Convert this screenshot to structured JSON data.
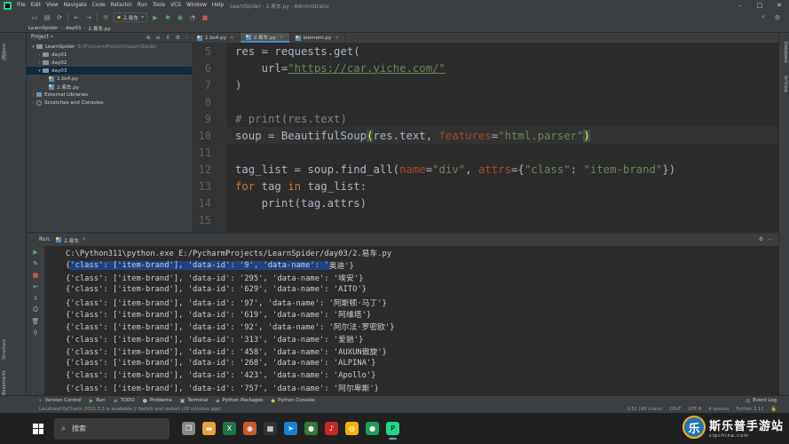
{
  "window": {
    "menu": [
      "File",
      "Edit",
      "View",
      "Navigate",
      "Code",
      "Refactor",
      "Run",
      "Tools",
      "VCS",
      "Window",
      "Help"
    ],
    "title": "LearnSpider - 2.易车.py - Administrator"
  },
  "toolbar": {
    "run_config": "2.易车"
  },
  "breadcrumb": [
    "LearnSpider",
    "day03",
    "2.易车.py"
  ],
  "left_stripe": {
    "project": "Project",
    "structure": "Structure",
    "bookmarks": "Bookmarks"
  },
  "right_stripe": {
    "database": "Database",
    "sciview": "SciView"
  },
  "project_panel": {
    "title": "Project",
    "tree": [
      {
        "label": "LearnSpider",
        "path": "E:\\PycharmProjects\\LearnSpider",
        "type": "folder",
        "indent": 0,
        "expanded": true
      },
      {
        "label": "day01",
        "type": "folder",
        "indent": 1
      },
      {
        "label": "day02",
        "type": "folder",
        "indent": 1
      },
      {
        "label": "day03",
        "type": "folder",
        "indent": 1,
        "expanded": true,
        "selected": true
      },
      {
        "label": "1.bs4.py",
        "type": "py",
        "indent": 2
      },
      {
        "label": "2.易车.py",
        "type": "py",
        "indent": 2
      },
      {
        "label": "External Libraries",
        "type": "lib",
        "indent": 0
      },
      {
        "label": "Scratches and Consoles",
        "type": "scratch",
        "indent": 0
      }
    ]
  },
  "editor": {
    "tabs": [
      "1.bs4.py",
      "2.易车.py",
      "element.py"
    ],
    "active_tab": 1,
    "line_numbers": [
      "5",
      "6",
      "7",
      "8",
      "9",
      "10",
      "11",
      "12",
      "13",
      "14",
      "15"
    ],
    "lines": {
      "l5_a": "res = requests.get(",
      "l6_a": "    url=",
      "l6_url": "\"https://car.yiche.com/\"",
      "l7_a": ")",
      "l9_comment": "# print(res.text)",
      "l10_a": "soup = BeautifulSoup",
      "l10_paren_open": "(",
      "l10_b": "res.text, ",
      "l10_kw": "features",
      "l10_c": "=",
      "l10_str": "\"html.parser\"",
      "l10_paren_close": ")",
      "l12_a": "tag_list = soup.find_all(",
      "l12_kw1": "name",
      "l12_b": "=",
      "l12_s1": "\"div\"",
      "l12_c": ", ",
      "l12_kw2": "attrs",
      "l12_d": "={",
      "l12_s2": "\"class\"",
      "l12_e": ": ",
      "l12_s3": "\"item-brand\"",
      "l12_f": "})",
      "l13_for": "for",
      "l13_a": " tag ",
      "l13_in": "in",
      "l13_b": " tag_list:",
      "l14_a": "    print(tag.attrs)"
    }
  },
  "run_panel": {
    "label": "Run:",
    "tab": "2.易车",
    "command": "C:\\Python311\\python.exe E:/PycharmProjects/LearnSpider/day03/2.易车.py",
    "first_line_selected": "'class': ['item-brand'], 'data-id': '9', 'data-name': '",
    "first_line_rest": "奥迪'}",
    "output": [
      "{'class': ['item-brand'], 'data-id': '295', 'data-name': '埃安'}",
      "{'class': ['item-brand'], 'data-id': '629', 'data-name': 'AITO'}",
      "{'class': ['item-brand'], 'data-id': '97', 'data-name': '阿斯顿·马丁'}",
      "{'class': ['item-brand'], 'data-id': '619', 'data-name': '阿维塔'}",
      "{'class': ['item-brand'], 'data-id': '92', 'data-name': '阿尔法·罗密欧'}",
      "{'class': ['item-brand'], 'data-id': '313', 'data-name': '爱驰'}",
      "{'class': ['item-brand'], 'data-id': '458', 'data-name': 'AUXUN傲旋'}",
      "{'class': ['item-brand'], 'data-id': '268', 'data-name': 'ALPINA'}",
      "{'class': ['item-brand'], 'data-id': '423', 'data-name': 'Apollo'}",
      "{'class': ['item-brand'], 'data-id': '757', 'data-name': '阿尔卑斯'}"
    ]
  },
  "tool_tabs": [
    "Version Control",
    "Run",
    "TODO",
    "Problems",
    "Terminal",
    "Python Packages",
    "Python Console"
  ],
  "event_log": "Event Log",
  "status": {
    "message": "Localized PyCharm 2021.3.3 is available // Switch and restart (20 minutes ago)",
    "position": "2:51 (49 chars)",
    "line_sep": "CRLF",
    "encoding": "UTF-8",
    "indent": "4 spaces",
    "interpreter": "Python 3.11"
  },
  "taskbar": {
    "search_placeholder": "搜索"
  },
  "watermark": {
    "title": "斯乐普手游站",
    "subtitle": "slpchina.com"
  }
}
